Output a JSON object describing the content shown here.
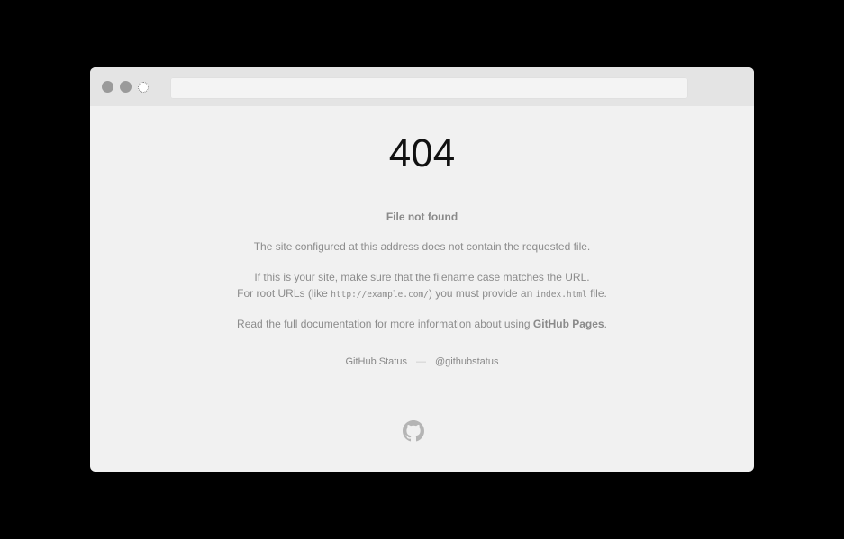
{
  "window": {
    "address": ""
  },
  "error": {
    "code": "404",
    "title": "File not found",
    "line1": "The site configured at this address does not contain the requested file.",
    "line2": "If this is your site, make sure that the filename case matches the URL.",
    "line3_prefix": "For root URLs (like ",
    "line3_code1": "http://example.com/",
    "line3_middle": ") you must provide an ",
    "line3_code2": "index.html",
    "line3_suffix": " file.",
    "line4_prefix": "Read the full documentation for more information about using ",
    "line4_link": "GitHub Pages",
    "line4_suffix": "."
  },
  "footer": {
    "status_link": "GitHub Status",
    "separator": "—",
    "twitter_link": "@githubstatus"
  },
  "icons": {
    "footer_logo": "github-octocat-icon"
  },
  "colors": {
    "page_bg": "#000000",
    "window_bg": "#f1f1f1",
    "titlebar_bg": "#e4e4e4",
    "text": "#8c8c8c",
    "heading": "#111111"
  }
}
